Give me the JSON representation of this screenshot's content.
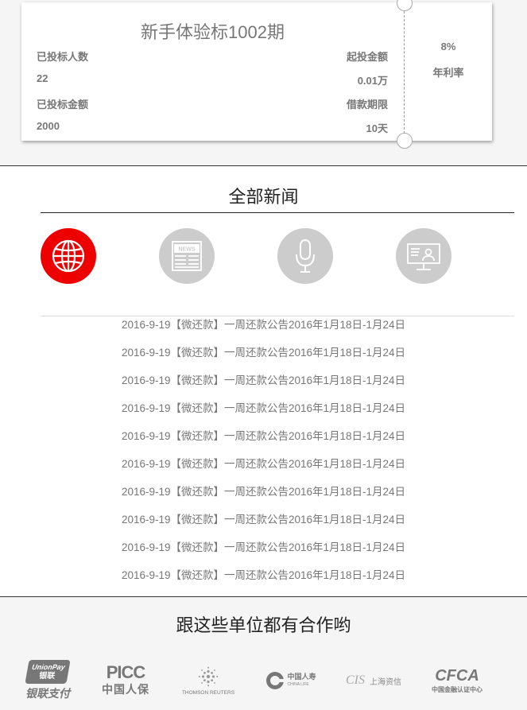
{
  "product": {
    "title": "新手体验标1002期",
    "investors_label": "已投标人数",
    "investors_value": "22",
    "min_invest_label": "起投金额",
    "min_invest_value": "0.01万",
    "invested_amount_label": "已投标金额",
    "invested_amount_value": "2000",
    "term_label": "借款期限",
    "term_value": "10天",
    "rate_value": "8%",
    "rate_label": "年利率"
  },
  "news": {
    "title": "全部新闻",
    "categories": [
      {
        "icon": "globe-icon",
        "active": true
      },
      {
        "icon": "newspaper-icon",
        "active": false
      },
      {
        "icon": "microphone-icon",
        "active": false
      },
      {
        "icon": "monitor-icon",
        "active": false
      }
    ],
    "items": [
      "2016-9-19【微还款】一周还款公告2016年1月18日-1月24日",
      "2016-9-19【微还款】一周还款公告2016年1月18日-1月24日",
      "2016-9-19【微还款】一周还款公告2016年1月18日-1月24日",
      "2016-9-19【微还款】一周还款公告2016年1月18日-1月24日",
      "2016-9-19【微还款】一周还款公告2016年1月18日-1月24日",
      "2016-9-19【微还款】一周还款公告2016年1月18日-1月24日",
      "2016-9-19【微还款】一周还款公告2016年1月18日-1月24日",
      "2016-9-19【微还款】一周还款公告2016年1月18日-1月24日",
      "2016-9-19【微还款】一周还款公告2016年1月18日-1月24日",
      "2016-9-19【微还款】一周还款公告2016年1月18日-1月24日"
    ],
    "news_icon_text": "NEWS"
  },
  "partners": {
    "title": "跟这些单位都有合作哟",
    "logos": {
      "unionpay_top": "UnionPay",
      "unionpay_cn": "银联",
      "unionpay_sub": "银联支付",
      "picc_top": "PICC",
      "picc_sub": "中国人保",
      "thomson": "THOMSON REUTERS",
      "chinalife_cn": "中国人寿",
      "chinalife_en": "CHINA LIFE",
      "cis": "CIS",
      "cis_cn": "上海资信",
      "cfca": "CFCA",
      "cfca_sub": "中国金融认证中心"
    }
  },
  "colors": {
    "accent": "#ee0000",
    "inactive_icon": "#cccccc"
  }
}
